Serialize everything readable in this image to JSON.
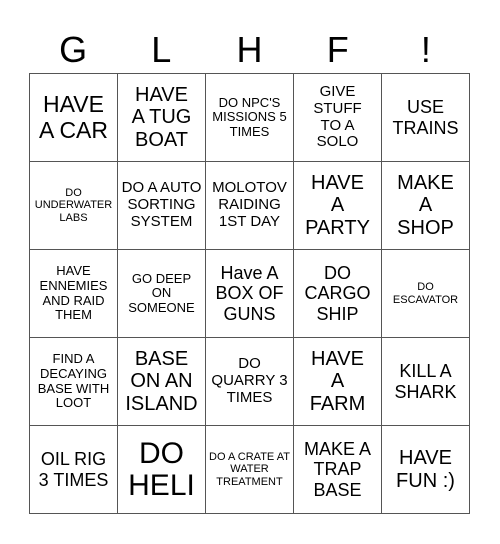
{
  "header": {
    "letters": [
      "G",
      "L",
      "H",
      "F",
      "!"
    ]
  },
  "cells": [
    [
      "HAVE A CAR",
      "HAVE A TUG BOAT",
      "DO NPC'S MISSIONS 5 TIMES",
      "GIVE STUFF TO A SOLO",
      "USE TRAINS"
    ],
    [
      "DO UNDERWATER LABS",
      "DO A AUTO SORTING SYSTEM",
      "MOLOTOV RAIDING 1ST DAY",
      "HAVE A PARTY",
      "MAKE A SHOP"
    ],
    [
      "HAVE ENNEMIES AND RAID THEM",
      "GO DEEP ON SOMEONE",
      "Have A BOX OF GUNS",
      "DO CARGO SHIP",
      "DO ESCAVATOR"
    ],
    [
      "FIND A DECAYING BASE WITH LOOT",
      "BASE ON AN ISLAND",
      "DO QUARRY 3 TIMES",
      "HAVE A FARM",
      "KILL A SHARK"
    ],
    [
      "OIL RIG 3 TIMES",
      "DO HELI",
      "DO A CRATE AT WATER TREATMENT",
      "MAKE A TRAP BASE",
      "HAVE FUN :)"
    ]
  ]
}
